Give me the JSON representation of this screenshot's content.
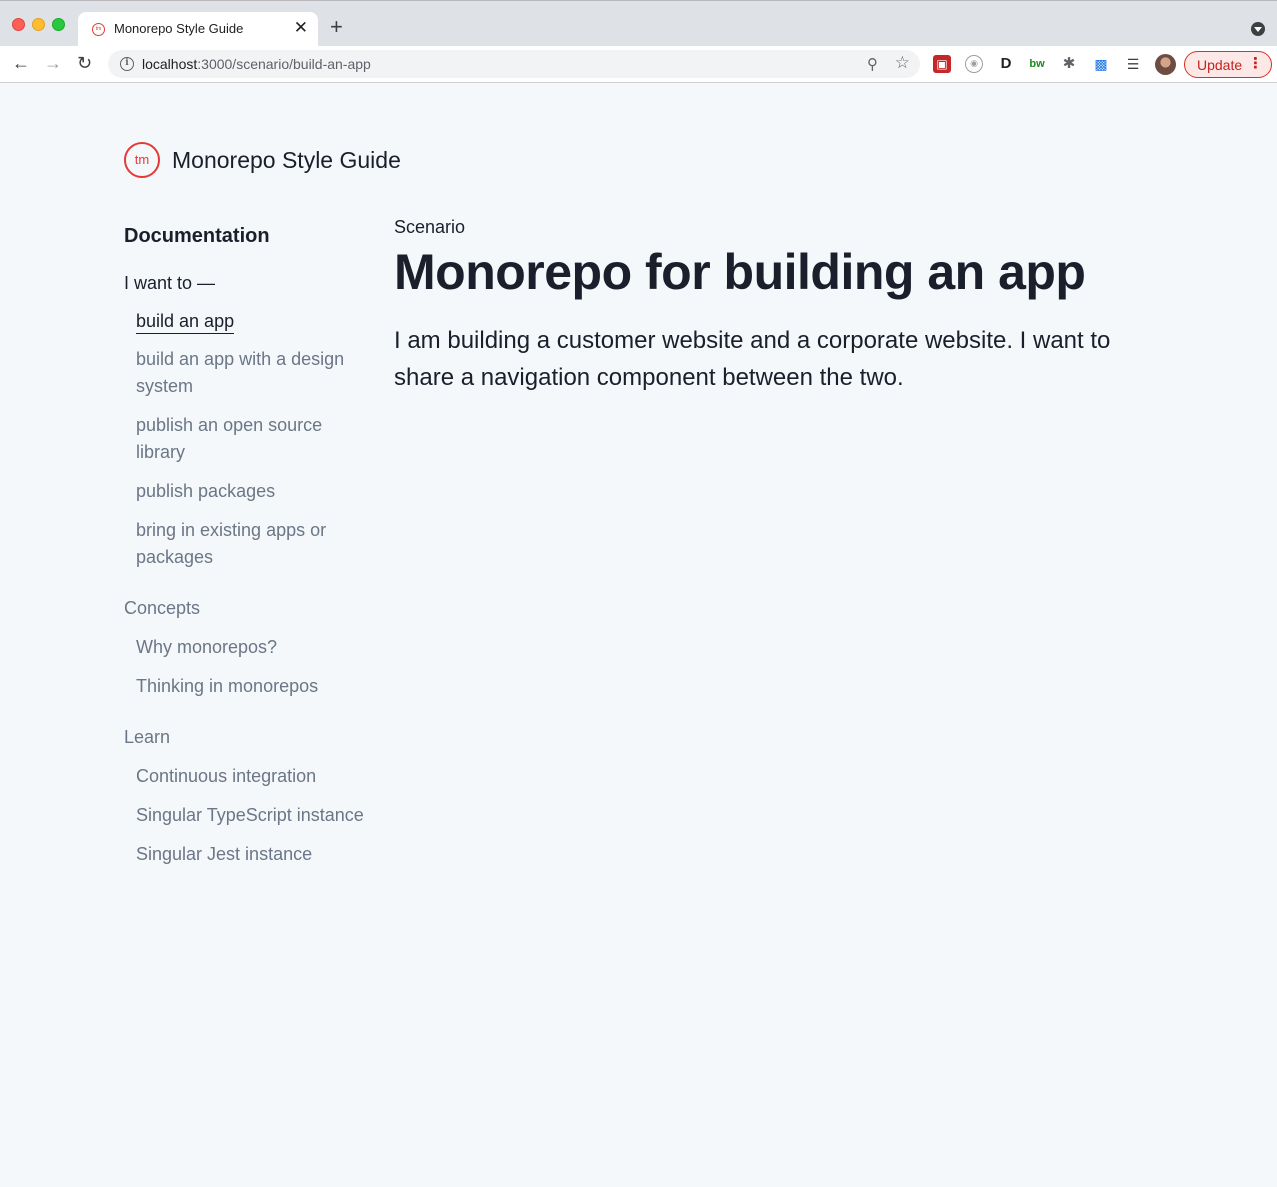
{
  "browser": {
    "tab_title": "Monorepo Style Guide",
    "tab_favicon_text": "tm",
    "tab_close_glyph": "✕",
    "new_tab_glyph": "+",
    "url_host": "localhost",
    "url_path": ":3000/scenario/build-an-app",
    "update_label": "Update",
    "icons": [
      "back-icon",
      "forward-icon",
      "reload-icon",
      "info-icon",
      "zoom-icon",
      "star-icon",
      "extensions-icon",
      "cast-icon",
      "media-icon",
      "menu-icon"
    ]
  },
  "site": {
    "logo_text": "tm",
    "title": "Monorepo Style Guide",
    "accent_color": "#e53935"
  },
  "sidebar": {
    "heading": "Documentation",
    "groups": [
      {
        "label": "I want to —",
        "items": [
          {
            "label": "build an app",
            "current": true
          },
          {
            "label": "build an app with a design system"
          },
          {
            "label": "publish an open source library"
          },
          {
            "label": "publish packages"
          },
          {
            "label": "bring in existing apps or packages"
          }
        ]
      },
      {
        "label": "Concepts",
        "items": [
          {
            "label": "Why monorepos?"
          },
          {
            "label": "Thinking in monorepos"
          }
        ]
      },
      {
        "label": "Learn",
        "items": [
          {
            "label": "Continuous integration"
          },
          {
            "label": "Singular TypeScript instance"
          },
          {
            "label": "Singular Jest instance"
          }
        ]
      }
    ]
  },
  "main": {
    "eyebrow": "Scenario",
    "title": "Monorepo for building an app",
    "lede": "I am building a customer website and a corporate website. I want to share a navigation component between the two."
  }
}
